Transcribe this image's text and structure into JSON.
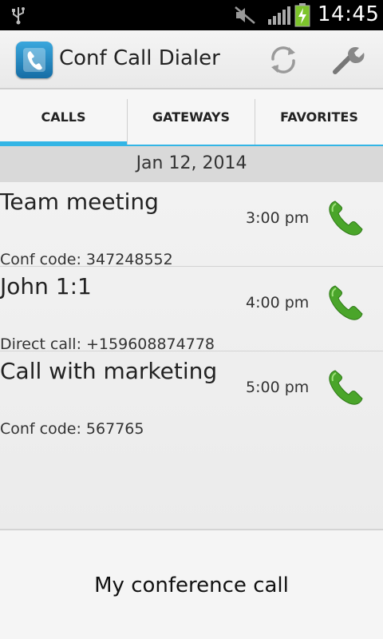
{
  "status_bar": {
    "time": "14:45",
    "icons": [
      "usb-icon",
      "mute-icon",
      "signal-icon",
      "battery-charging-icon"
    ]
  },
  "action_bar": {
    "app_title": "Conf Call Dialer",
    "icons": [
      "app-phone-icon",
      "refresh-icon",
      "wrench-icon"
    ]
  },
  "tabs": [
    {
      "label": "CALLS",
      "active": true
    },
    {
      "label": "GATEWAYS",
      "active": false
    },
    {
      "label": "FAVORITES",
      "active": false
    }
  ],
  "date_header": "Jan 12, 2014",
  "calls": [
    {
      "title": "Team meeting",
      "time": "3:00 pm",
      "detail": "Conf code: 347248552"
    },
    {
      "title": "John 1:1",
      "time": "4:00 pm",
      "detail": "Direct call: +159608874778"
    },
    {
      "title": "Call with marketing",
      "time": "5:00 pm",
      "detail": "Conf code: 567765"
    }
  ],
  "bottom_panel": {
    "label": "My conference call"
  },
  "colors": {
    "accent": "#33b5e5",
    "status_bar": "#000000",
    "phone_green": "#4aa52a",
    "app_icon_blue": "#1f86c4"
  }
}
